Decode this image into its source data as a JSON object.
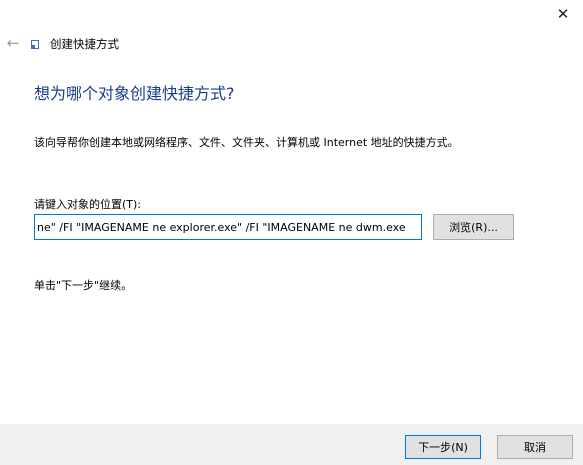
{
  "window": {
    "close_glyph": "✕"
  },
  "nav": {
    "back_glyph": "←",
    "title": "创建快捷方式"
  },
  "main": {
    "heading": "想为哪个对象创建快捷方式?",
    "description": "该向导帮你创建本地或网络程序、文件、文件夹、计算机或 Internet 地址的快捷方式。",
    "location_label": "请键入对象的位置(T):",
    "location_value": "ne\" /FI \"IMAGENAME ne explorer.exe\" /FI \"IMAGENAME ne dwm.exe",
    "browse_label": "浏览(R)...",
    "continue_hint": "单击\"下一步\"继续。"
  },
  "footer": {
    "next_label": "下一步(N)",
    "cancel_label": "取消"
  },
  "icons": {
    "back": "back-arrow-icon",
    "wizard": "shortcut-wizard-icon",
    "close": "close-icon"
  },
  "colors": {
    "heading": "#1a3e8c",
    "focus_border": "#0078d7",
    "button_bg": "#e1e1e1",
    "footer_bg": "#f0f0f0"
  }
}
